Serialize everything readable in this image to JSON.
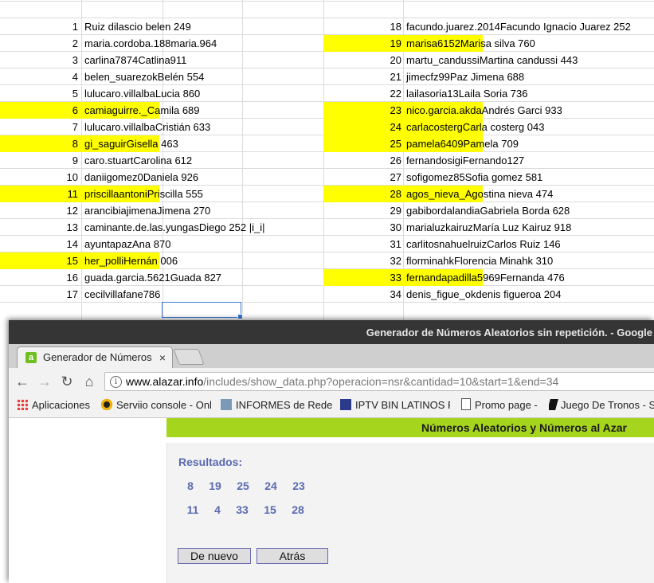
{
  "spreadsheet": {
    "left_rows": [
      {
        "n": "1",
        "text": "Ruiz dilascio belen 249",
        "hl": false
      },
      {
        "n": "2",
        "text": "maria.cordoba.188maria.964",
        "hl": false
      },
      {
        "n": "3",
        "text": "carlina7874Catlina911",
        "hl": false
      },
      {
        "n": "4",
        "text": "belen_suarezokBelén 554",
        "hl": false
      },
      {
        "n": "5",
        "text": "lulucaro.villalbaLucia 860",
        "hl": false
      },
      {
        "n": "6",
        "text": "camiaguirre._Camila 689",
        "hl": true
      },
      {
        "n": "7",
        "text": "lulucaro.villalbaCristián 633",
        "hl": false
      },
      {
        "n": "8",
        "text": "gi_saguirGisella 463",
        "hl": true
      },
      {
        "n": "9",
        "text": "caro.stuartCarolina 612",
        "hl": false
      },
      {
        "n": "10",
        "text": "daniigomez0Daniela 926",
        "hl": false
      },
      {
        "n": "11",
        "text": "priscillaantoniPriscilla 555",
        "hl": true
      },
      {
        "n": "12",
        "text": "arancibiajimenaJimena 270",
        "hl": false
      },
      {
        "n": "13",
        "text": "caminante.de.las.yungasDiego 252 |i_i|",
        "hl": false
      },
      {
        "n": "14",
        "text": "ayuntapazAna 870",
        "hl": false
      },
      {
        "n": "15",
        "text": "her_polliHernán 006",
        "hl": true
      },
      {
        "n": "16",
        "text": "guada.garcia.5621Guada 827",
        "hl": false
      },
      {
        "n": "17",
        "text": "cecilvillafane786",
        "hl": false
      }
    ],
    "right_rows": [
      {
        "n": "18",
        "text": "facundo.juarez.2014Facundo Ignacio Juarez 252",
        "hl": false
      },
      {
        "n": "19",
        "text": "marisa6152Marisa silva 760",
        "hl": true
      },
      {
        "n": "20",
        "text": "martu_candussiMartina candussi 443",
        "hl": false
      },
      {
        "n": "21",
        "text": "jimecfz99Paz Jimena 688",
        "hl": false
      },
      {
        "n": "22",
        "text": "lailasoria13Laila Soria 736",
        "hl": false
      },
      {
        "n": "23",
        "text": "nico.garcia.akdaAndrés Garci 933",
        "hl": true
      },
      {
        "n": "24",
        "text": "carlacostergCarla costerg 043",
        "hl": true
      },
      {
        "n": "25",
        "text": "pamela6409Pamela 709",
        "hl": true
      },
      {
        "n": "26",
        "text": "fernandosigiFernando127",
        "hl": false
      },
      {
        "n": "27",
        "text": "sofigomez85Sofia gomez 581",
        "hl": false
      },
      {
        "n": "28",
        "text": "agos_nieva_Agostina nieva 474",
        "hl": true
      },
      {
        "n": "29",
        "text": "gabibordalandiaGabriela Borda 628",
        "hl": false
      },
      {
        "n": "30",
        "text": "marialuzkairuzMaría Luz Kairuz 918",
        "hl": false
      },
      {
        "n": "31",
        "text": "carlitosnahuelruizCarlos Ruiz 146",
        "hl": false
      },
      {
        "n": "32",
        "text": "florminahkFlorencia Minahk 310",
        "hl": false
      },
      {
        "n": "33",
        "text": "fernandapadilla5969Fernanda 476",
        "hl": true
      },
      {
        "n": "34",
        "text": "denis_figue_okdenis figueroa 204",
        "hl": false
      }
    ],
    "highlight_color": "#ffff00"
  },
  "browser": {
    "window_title": "Generador de Números Aleatorios sin repetición. - Google",
    "tab_title": "Generador de Números",
    "tab_close": "×",
    "url_host": "www.alazar.info",
    "url_path": "/includes/show_data.php?operacion=nsr&cantidad=10&start=1&end=34",
    "bookmarks": [
      {
        "label": "Aplicaciones",
        "icon": "apps-grid-icon"
      },
      {
        "label": "Serviio console - Onl",
        "icon": "serviio-icon"
      },
      {
        "label": "INFORMES de Redes",
        "icon": "informes-icon"
      },
      {
        "label": "IPTV BIN LATINOS P",
        "icon": "iptv-icon"
      },
      {
        "label": "Promo page -",
        "icon": "page-icon"
      },
      {
        "label": "Juego De Tronos - S",
        "icon": "got-icon"
      }
    ]
  },
  "page": {
    "header": "Números Aleatorios y Números al Azar",
    "header_color": "#a6d51e",
    "results_label": "Resultados:",
    "results_row1": [
      "8",
      "19",
      "25",
      "24",
      "23"
    ],
    "results_row2": [
      "11",
      "4",
      "33",
      "15",
      "28"
    ],
    "btn_again": "De nuevo",
    "btn_back": "Atrás"
  }
}
